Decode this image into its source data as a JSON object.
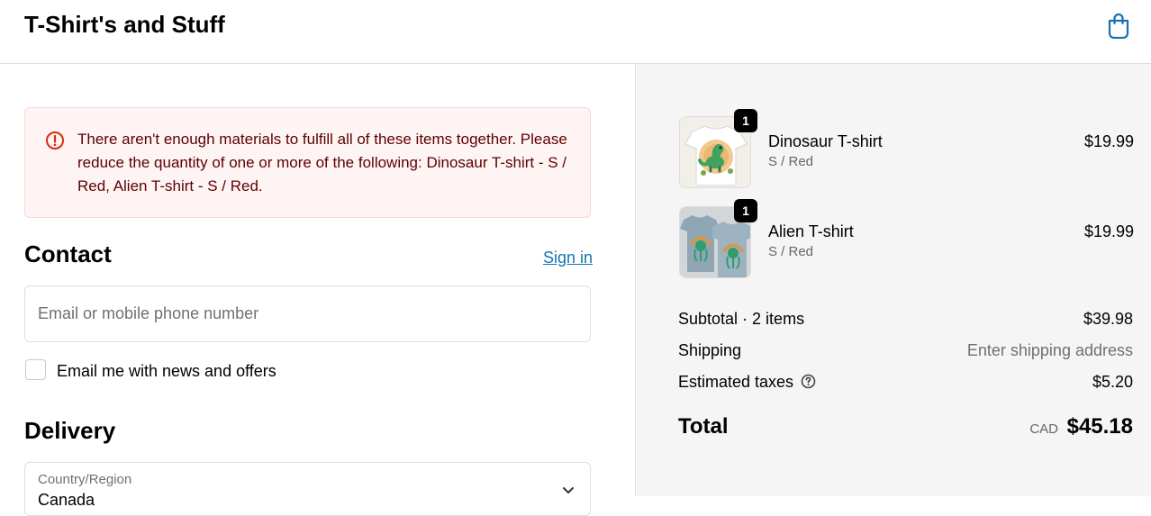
{
  "header": {
    "store_name": "T-Shirt's and Stuff",
    "cart_icon": "shopping-bag-icon"
  },
  "error": {
    "icon": "alert-circle-icon",
    "message": "There aren't enough materials to fulfill all of these items together. Please reduce the quantity of one or more of the following: Dinosaur T-shirt - S / Red, Alien T-shirt - S / Red."
  },
  "contact": {
    "title": "Contact",
    "sign_in": "Sign in",
    "email_placeholder": "Email or mobile phone number",
    "newsletter_label": "Email me with news and offers"
  },
  "delivery": {
    "title": "Delivery",
    "country_label": "Country/Region",
    "country_value": "Canada"
  },
  "cart": {
    "items": [
      {
        "name": "Dinosaur T-shirt",
        "variant": "S / Red",
        "price": "$19.99",
        "quantity": "1"
      },
      {
        "name": "Alien T-shirt",
        "variant": "S / Red",
        "price": "$19.99",
        "quantity": "1"
      }
    ]
  },
  "summary": {
    "subtotal_label": "Subtotal · 2 items",
    "subtotal_value": "$39.98",
    "shipping_label": "Shipping",
    "shipping_value": "Enter shipping address",
    "taxes_label": "Estimated taxes",
    "taxes_value": "$5.20",
    "total_label": "Total",
    "total_currency": "CAD",
    "total_value": "$45.18"
  },
  "colors": {
    "accent": "#1773b0",
    "error_background": "#fff4f4",
    "error_text": "#5c0000",
    "error_icon": "#d82c0d",
    "summary_background": "#f5f5f5"
  }
}
